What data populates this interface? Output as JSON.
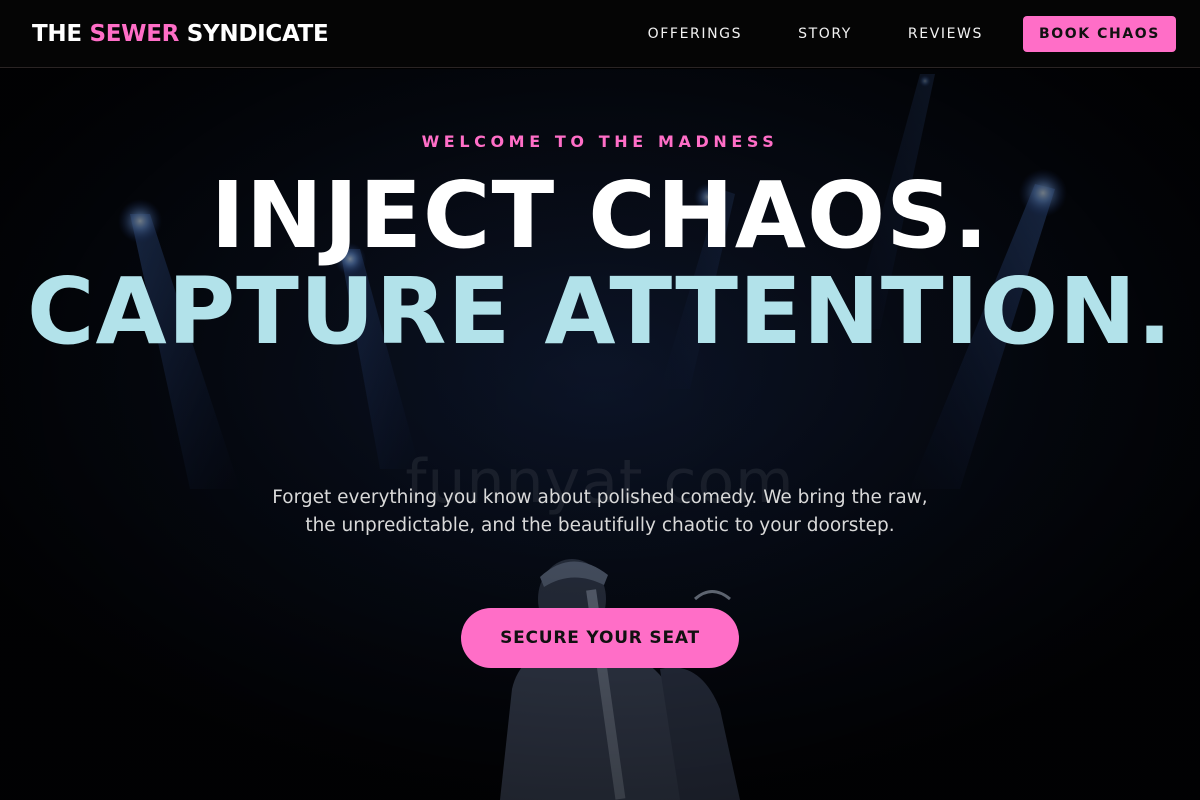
{
  "nav": {
    "brand_pre": "THE ",
    "brand_accent": "SEWER",
    "brand_post": " SYNDICATE",
    "links": [
      "OFFERINGS",
      "STORY",
      "REVIEWS"
    ],
    "cta": "BOOK CHAOS"
  },
  "hero": {
    "eyebrow": "WELCOME TO THE MADNESS",
    "headline_line1": "INJECT CHAOS.",
    "headline_line2": "CAPTURE ATTENTION.",
    "subtext": "Forget everything you know about polished comedy. We bring the raw, the unpredictable, and the beautifully chaotic to your doorstep.",
    "cta": "SECURE YOUR SEAT",
    "watermark": "funnyat.com"
  },
  "colors": {
    "accent_pink": "#ff6ec7",
    "accent_cyan": "#b2e2ea",
    "background": "#000000"
  }
}
